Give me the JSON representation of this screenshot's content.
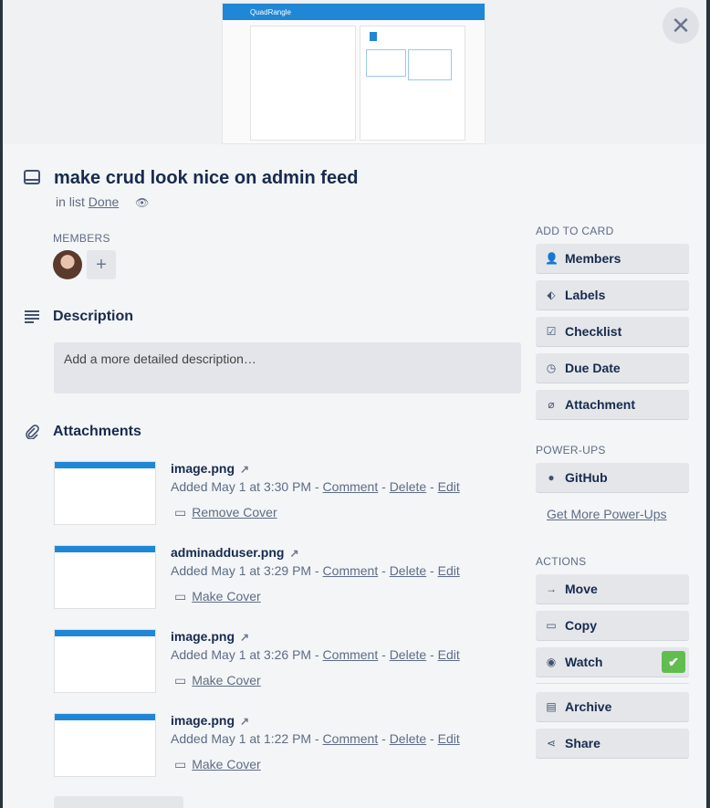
{
  "cover": {
    "brand": "QuadRangle"
  },
  "card": {
    "title": "make crud look nice on admin feed",
    "in_list_prefix": "in list",
    "list_name": "Done"
  },
  "members": {
    "label": "MEMBERS",
    "add": "+"
  },
  "description": {
    "title": "Description",
    "placeholder": "Add a more detailed description…"
  },
  "attachments": {
    "title": "Attachments",
    "items": [
      {
        "name": "image.png",
        "added": "Added May 1 at 3:30 PM",
        "sep": "-",
        "comment": "Comment",
        "delete": "Delete",
        "edit": "Edit",
        "cover_action": "Remove Cover"
      },
      {
        "name": "adminadduser.png",
        "added": "Added May 1 at 3:29 PM",
        "sep": "-",
        "comment": "Comment",
        "delete": "Delete",
        "edit": "Edit",
        "cover_action": "Make Cover"
      },
      {
        "name": "image.png",
        "added": "Added May 1 at 3:26 PM",
        "sep": "-",
        "comment": "Comment",
        "delete": "Delete",
        "edit": "Edit",
        "cover_action": "Make Cover"
      },
      {
        "name": "image.png",
        "added": "Added May 1 at 1:22 PM",
        "sep": "-",
        "comment": "Comment",
        "delete": "Delete",
        "edit": "Edit",
        "cover_action": "Make Cover"
      }
    ]
  },
  "sidebar": {
    "add_to_card_label": "ADD TO CARD",
    "add_to_card": [
      "Members",
      "Labels",
      "Checklist",
      "Due Date",
      "Attachment"
    ],
    "powerups_label": "POWER-UPS",
    "powerups": [
      "GitHub"
    ],
    "get_more": "Get More Power-Ups",
    "actions_label": "ACTIONS",
    "actions": [
      "Move",
      "Copy",
      "Watch",
      "Archive",
      "Share"
    ]
  },
  "colors": {
    "accent": "#1f87d6",
    "watch_check": "#61bd4f"
  }
}
